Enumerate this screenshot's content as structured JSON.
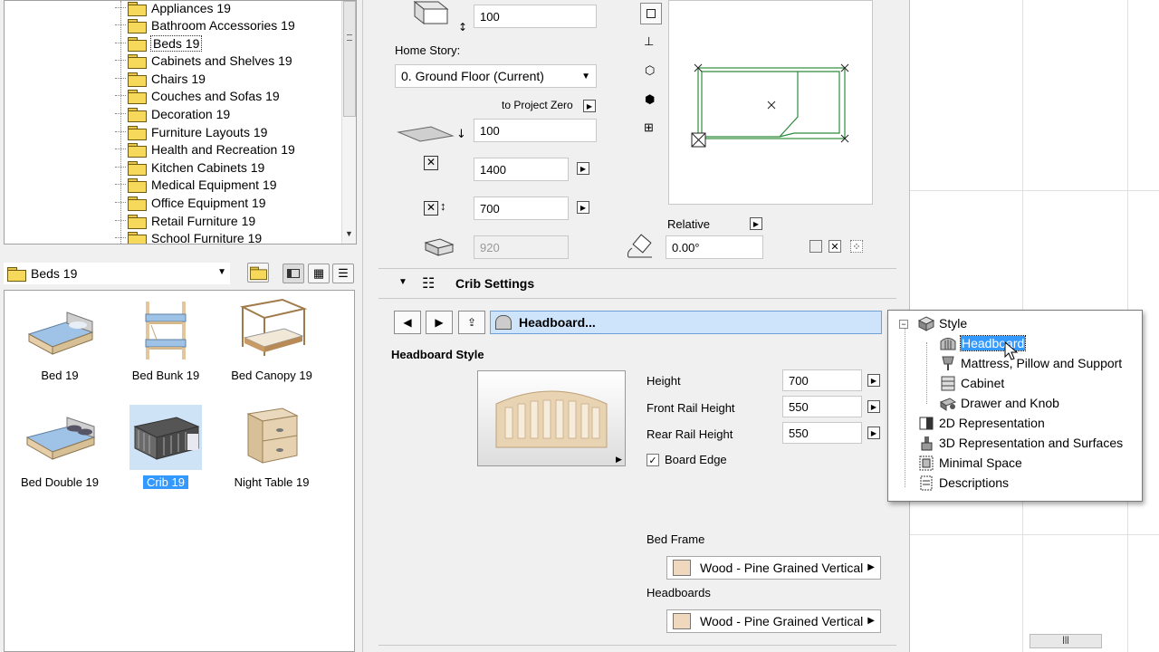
{
  "library": {
    "folders": [
      "Appliances 19",
      "Bathroom Accessories 19",
      "Beds 19",
      "Cabinets and Shelves 19",
      "Chairs 19",
      "Couches and Sofas 19",
      "Decoration 19",
      "Furniture Layouts 19",
      "Health and Recreation 19",
      "Kitchen Cabinets 19",
      "Medical Equipment 19",
      "Office Equipment 19",
      "Retail Furniture 19",
      "School Furniture 19"
    ],
    "selected_folder": "Beds 19",
    "current_folder": "Beds 19",
    "items": [
      {
        "label": "Bed 19"
      },
      {
        "label": "Bed Bunk 19"
      },
      {
        "label": "Bed Canopy 19"
      },
      {
        "label": "Bed Double 19"
      },
      {
        "label": "Crib 19"
      },
      {
        "label": "Night Table 19"
      }
    ],
    "selected_item": "Crib 19"
  },
  "settings": {
    "top_value": "100",
    "home_story_label": "Home Story:",
    "home_story_value": "0. Ground Floor (Current)",
    "to_project_zero_label": "to Project Zero",
    "elevation_value": "100",
    "width_value": "1400",
    "depth_value": "700",
    "height_value": "920",
    "relative_label": "Relative",
    "angle_value": "0.00°",
    "section_title": "Crib Settings",
    "page_title": "Headboard...",
    "headboard_style_label": "Headboard Style",
    "params": [
      {
        "label": "Height",
        "value": "700"
      },
      {
        "label": "Front Rail Height",
        "value": "550"
      },
      {
        "label": "Rear Rail Height",
        "value": "550"
      }
    ],
    "board_edge_label": "Board Edge",
    "board_edge_checked": true,
    "bed_frame_label": "Bed Frame",
    "bed_frame_material": "Wood - Pine Grained Vertical",
    "headboards_label": "Headboards",
    "headboards_material": "Wood - Pine Grained Vertical"
  },
  "popup": {
    "root": "Style",
    "children": [
      "Headboard",
      "Mattress, Pillow and Support",
      "Cabinet",
      "Drawer and Knob"
    ],
    "selected": "Headboard",
    "others": [
      "2D Representation",
      "3D Representation and Surfaces",
      "Minimal Space",
      "Descriptions"
    ]
  },
  "colors": {
    "selection": "#3399ff",
    "picker_bg": "#cde4fb",
    "swatch": "#f0d8be",
    "plan_line": "#2e8b3a"
  }
}
